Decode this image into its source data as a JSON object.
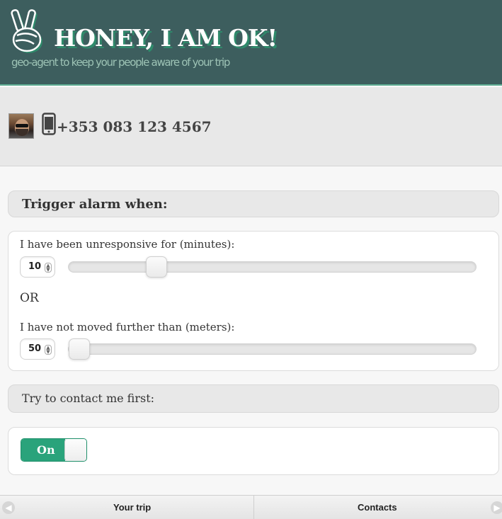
{
  "header": {
    "title": "HONEY, I AM OK!",
    "subtitle": "geo-agent to keep your people aware of your trip",
    "logo_icon": "peace-hand-icon"
  },
  "profile": {
    "avatar_icon": "avatar",
    "phone_icon": "smartphone-icon",
    "phone_number": "+353 083 123 4567"
  },
  "alarm": {
    "section_title": "Trigger alarm when:",
    "unresponsive_label": "I have been unresponsive for (minutes):",
    "unresponsive_value": "10",
    "unresponsive_slider_fraction": 0.2,
    "or_label": "OR",
    "distance_label": "I have not moved further than (meters):",
    "distance_value": "50",
    "distance_slider_fraction": 0.0
  },
  "contact": {
    "section_title": "Try to contact me first:",
    "toggle_label": "On",
    "toggle_state": "on"
  },
  "footer": {
    "prev_label": "Your trip",
    "next_label": "Contacts",
    "prev_icon": "arrow-left-icon",
    "next_icon": "arrow-right-icon"
  },
  "colors": {
    "header_bg": "#3d5e5e",
    "accent": "#2aa37b"
  }
}
